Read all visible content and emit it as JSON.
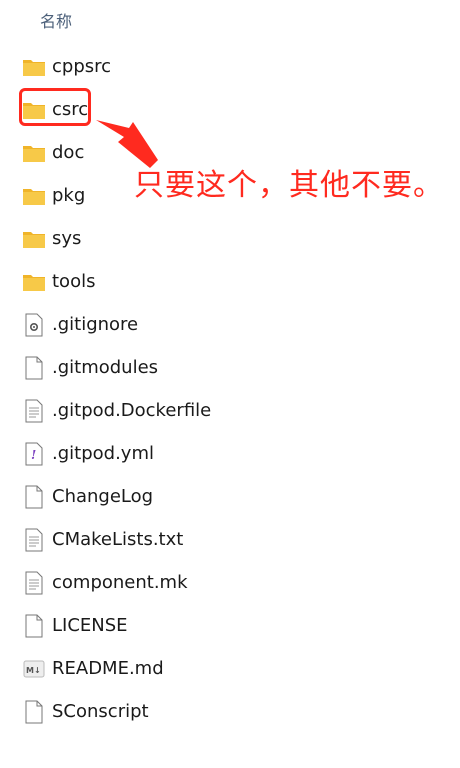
{
  "header": {
    "column_name": "名称"
  },
  "files": [
    {
      "name": "cppsrc",
      "icon": "folder-icon"
    },
    {
      "name": "csrc",
      "icon": "folder-icon"
    },
    {
      "name": "doc",
      "icon": "folder-icon"
    },
    {
      "name": "pkg",
      "icon": "folder-icon"
    },
    {
      "name": "sys",
      "icon": "folder-icon"
    },
    {
      "name": "tools",
      "icon": "folder-icon"
    },
    {
      "name": ".gitignore",
      "icon": "settings-file-icon"
    },
    {
      "name": ".gitmodules",
      "icon": "blank-file-icon"
    },
    {
      "name": ".gitpod.Dockerfile",
      "icon": "text-file-icon"
    },
    {
      "name": ".gitpod.yml",
      "icon": "yml-file-icon"
    },
    {
      "name": "ChangeLog",
      "icon": "blank-file-icon"
    },
    {
      "name": "CMakeLists.txt",
      "icon": "text-file-icon"
    },
    {
      "name": "component.mk",
      "icon": "text-file-icon"
    },
    {
      "name": "LICENSE",
      "icon": "blank-file-icon"
    },
    {
      "name": "README.md",
      "icon": "markdown-file-icon"
    },
    {
      "name": "SConscript",
      "icon": "blank-file-icon"
    }
  ],
  "annotation": {
    "text": "只要这个，其他不要。",
    "color": "#ff2a1f"
  },
  "colors": {
    "folder": "#f7c948",
    "folder_tab": "#f0b429",
    "accent_red": "#ff2a1f"
  }
}
